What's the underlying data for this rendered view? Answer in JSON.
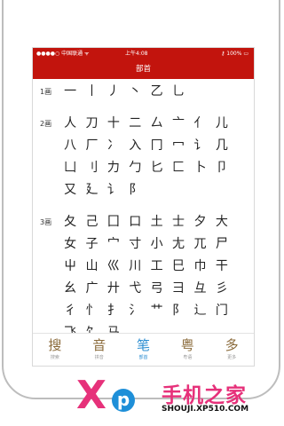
{
  "status_bar": {
    "carrier": "●●●●○ 中国联通 ᯤ",
    "time": "上午4:08",
    "battery": "⚷ 100% ▭"
  },
  "nav": {
    "title": "部首"
  },
  "groups": [
    {
      "label": "1画",
      "glyphs": [
        "一",
        "丨",
        "丿",
        "丶",
        "乙",
        "乚"
      ]
    },
    {
      "label": "2画",
      "glyphs": [
        "人",
        "刀",
        "十",
        "二",
        "厶",
        "亠",
        "亻",
        "儿",
        "八",
        "厂",
        "冫",
        "入",
        "冂",
        "冖",
        "讠",
        "几",
        "凵",
        "刂",
        "力",
        "勹",
        "匕",
        "匚",
        "卜",
        "卩",
        "又",
        "廴",
        "讠",
        "阝"
      ]
    },
    {
      "label": "3画",
      "glyphs": [
        "夂",
        "己",
        "囗",
        "口",
        "土",
        "士",
        "夕",
        "大",
        "女",
        "子",
        "宀",
        "寸",
        "小",
        "尢",
        "兀",
        "尸",
        "屮",
        "山",
        "巛",
        "川",
        "工",
        "巳",
        "巾",
        "干",
        "幺",
        "广",
        "廾",
        "弋",
        "弓",
        "彐",
        "彑",
        "彡",
        "彳",
        "忄",
        "扌",
        "氵",
        "艹",
        "阝",
        "辶",
        "门",
        "飞",
        "饣",
        "马"
      ]
    }
  ],
  "tabs": [
    {
      "icon": "搜",
      "label": "搜索"
    },
    {
      "icon": "音",
      "label": "拼音"
    },
    {
      "icon": "笔",
      "label": "部首"
    },
    {
      "icon": "粤",
      "label": "粤语"
    },
    {
      "icon": "多",
      "label": "更多"
    }
  ],
  "watermark": {
    "logo_x": "X",
    "logo_p": "p",
    "cn": "手机之家",
    "url": "SHOUJI.XP510.COM"
  },
  "colors": {
    "brand_red": "#c2140d",
    "active_tab": "#2e8fd2",
    "watermark_pink": "#e6317a"
  }
}
